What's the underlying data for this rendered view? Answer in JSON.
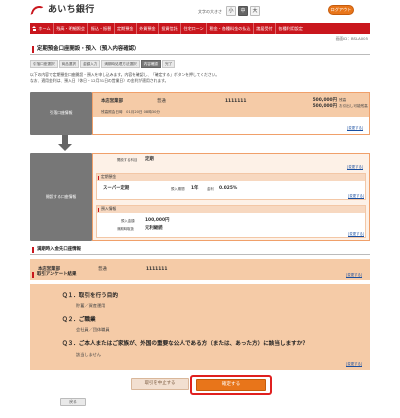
{
  "header": {
    "bank_name": "あいち銀行",
    "font_size_label": "文字の大きさ",
    "font_sizes": [
      "小",
      "中",
      "大"
    ],
    "selected_font_size": "中",
    "logout_label": "ログアウト"
  },
  "nav": {
    "items": [
      "ホーム",
      "残高・明細照会",
      "振込・振替",
      "定期預金",
      "外貨預金",
      "投資信託",
      "住宅ローン",
      "税金・各種料金の払込",
      "諸届受付",
      "各種利用設定"
    ]
  },
  "screen_id": "画面ID：BSLA005",
  "page_title": "定期預金口座開設・預入（預入内容確認）",
  "steps": [
    {
      "label": "引落口座選択",
      "active": false
    },
    {
      "label": "商品選択",
      "active": false
    },
    {
      "label": "金額入力",
      "active": false
    },
    {
      "label": "満期時処理方法選択",
      "active": false
    },
    {
      "label": "内容確認",
      "active": true
    },
    {
      "label": "完了",
      "active": false
    }
  ],
  "intro": {
    "line1": "以下の内容で定期預金口座開設・預入を申し込みます。内容を確認し、「確定する」ボタンを押してください。",
    "line2": "なお、適用金利は、預入日（休日・12月31日の営業日）の金利が適用されます。"
  },
  "withdraw_account": {
    "label": "引落口座情報",
    "branch": "本店営業部",
    "type": "普通",
    "number": "1111111",
    "balance": "500,000円",
    "balance_label": "残高",
    "available": "500,000円",
    "available_label": "お引出し可能残高",
    "datetime": "残高照会日時　01月20日 08時30分",
    "edit_label": "[変更する]"
  },
  "new_deposit": {
    "label": "開設する口座情報",
    "account_kind_label": "開設する科目",
    "account_kind": "定期",
    "edit_label": "[変更する]",
    "product": {
      "section_title": "定期預金",
      "name": "スーパー定期",
      "term_label": "預入期間",
      "term": "1年",
      "rate_label": "金利",
      "rate": "0.025%"
    },
    "info": {
      "section_title": "預入情報",
      "amount_label": "預入金額",
      "amount": "100,000円",
      "maturity_label": "満期時取扱",
      "maturity": "元利継続"
    }
  },
  "transfer_section_title": "満期時入金先口座情報",
  "transfer_account": {
    "branch": "本店営業部",
    "type": "普通",
    "number": "1111111",
    "edit_label": "[変更する]"
  },
  "survey": {
    "title": "取引アンケート結果",
    "questions": [
      {
        "q": "Ｑ１．取引を行う目的",
        "a": "貯蓄／資産運用"
      },
      {
        "q": "Ｑ２．ご職業",
        "a": "会社員／団体職員"
      },
      {
        "q": "Ｑ３．ご本人またはご家族が、外国の重要な公人である方（または、あった方）に該当しますか？",
        "a": "該当しません"
      }
    ],
    "edit_label": "[変更する]"
  },
  "buttons": {
    "cancel": "取引を中止する",
    "confirm": "確定する",
    "back": "戻る"
  }
}
